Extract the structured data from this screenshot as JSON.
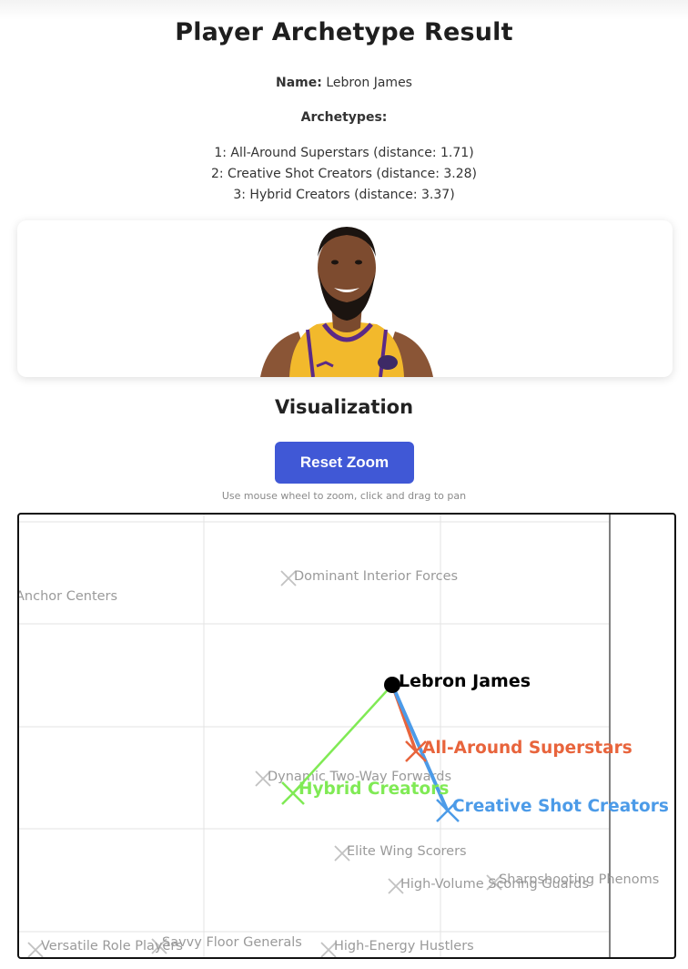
{
  "page": {
    "title": "Player Archetype Result",
    "name_label": "Name:",
    "name_value": "Lebron James",
    "archetypes_heading": "Archetypes:",
    "archetypes": [
      "1: All-Around Superstars (distance: 1.71)",
      "2: Creative Shot Creators (distance: 3.28)",
      "3: Hybrid Creators (distance: 3.37)"
    ]
  },
  "visualization": {
    "title": "Visualization",
    "reset_button": "Reset Zoom",
    "hint": "Use mouse wheel to zoom, click and drag to pan"
  },
  "colors": {
    "button": "#4058d6",
    "all_around": "#e8643c",
    "creative": "#4c9be8",
    "hybrid": "#80ea55",
    "player": "#000000",
    "cluster": "#bdbdbd"
  },
  "plot": {
    "player": {
      "label": "Lebron James"
    },
    "highlighted": [
      {
        "label": "All-Around Superstars",
        "color": "#e8643c"
      },
      {
        "label": "Hybrid Creators",
        "color": "#80ea55"
      },
      {
        "label": "Creative Shot Creators",
        "color": "#4c9be8"
      }
    ],
    "clusters": [
      "Anchor Centers",
      "Dominant Interior Forces",
      "Dynamic Two-Way Forwards",
      "Elite Wing Scorers",
      "High-Volume Scoring Guards",
      "Sharpshooting Phenoms",
      "Versatile Role Players",
      "Savvy Floor Generals",
      "High-Energy Hustlers"
    ]
  }
}
